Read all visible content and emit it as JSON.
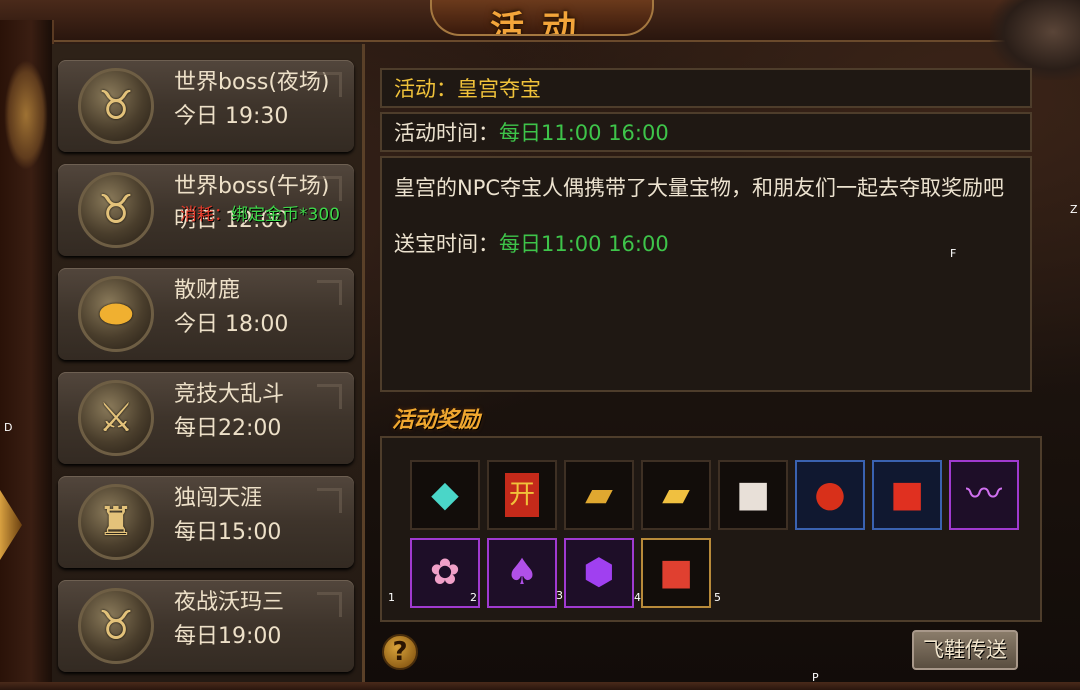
{
  "header": {
    "title": "活动"
  },
  "activities": [
    {
      "name": "世界boss(夜场)",
      "time": "今日 19:30",
      "icon": "bull-icon"
    },
    {
      "name": "世界boss(午场)",
      "time": "明日 12:00",
      "icon": "bull-icon"
    },
    {
      "name": "散财鹿",
      "time": "今日 18:00",
      "icon": "gold-ingot-icon"
    },
    {
      "name": "竞技大乱斗",
      "time": "每日22:00",
      "icon": "crossed-swords-icon"
    },
    {
      "name": "独闯天涯",
      "time": "每日15:00",
      "icon": "warrior-icon"
    },
    {
      "name": "夜战沃玛三",
      "time": "每日19:00",
      "icon": "bull-warrior-icon"
    }
  ],
  "overlay_cost": {
    "label": "消耗：",
    "value": "绑定金币*300"
  },
  "detail": {
    "name_label": "活动：",
    "name_value": "皇宫夺宝",
    "time_label": "活动时间：",
    "time_value": "每日11:00 16:00",
    "description": "皇宫的NPC夺宝人偶携带了大量宝物，和朋友们一起去夺取奖励吧",
    "send_label": "送宝时间：",
    "send_value": "每日11:00 16:00"
  },
  "rewards": {
    "title": "活动奖励",
    "items": [
      {
        "name": "crystal-icon",
        "glyph": "◆",
        "color": "#4ad6c8",
        "frame": "plain"
      },
      {
        "name": "red-envelope-icon",
        "glyph": "开",
        "color": "#f0c23a",
        "frame": "plain"
      },
      {
        "name": "gold-bar-icon",
        "glyph": "▰",
        "color": "#e0a830",
        "frame": "plain"
      },
      {
        "name": "gold-bars-icon",
        "glyph": "▰",
        "color": "#f0c040",
        "frame": "plain"
      },
      {
        "name": "gift-box-white-icon",
        "glyph": "■",
        "color": "#e8e0d8",
        "frame": "plain"
      },
      {
        "name": "lucky-bag-icon",
        "glyph": "●",
        "color": "#d8301a",
        "frame": "blue"
      },
      {
        "name": "gift-box-red-icon",
        "glyph": "■",
        "color": "#e03020",
        "frame": "blue"
      },
      {
        "name": "purple-wings-icon",
        "glyph": "〰",
        "color": "#d070f0",
        "frame": "purple"
      },
      {
        "name": "pink-pet-icon",
        "glyph": "✿",
        "color": "#f0a0c8",
        "frame": "purple"
      },
      {
        "name": "purple-figure-icon",
        "glyph": "♠",
        "color": "#b050e8",
        "frame": "purple"
      },
      {
        "name": "purple-shield-icon",
        "glyph": "⬢",
        "color": "#a040f0",
        "frame": "purple"
      },
      {
        "name": "gold-gift-box-icon",
        "glyph": "■",
        "color": "#e04030",
        "frame": "gold"
      }
    ],
    "slot_numbers": [
      "1",
      "2",
      "3",
      "4",
      "5"
    ]
  },
  "buttons": {
    "help": "?",
    "teleport": "飞鞋传送"
  },
  "stray_letters": {
    "z": "Z",
    "d": "D",
    "f": "F",
    "p": "P"
  }
}
